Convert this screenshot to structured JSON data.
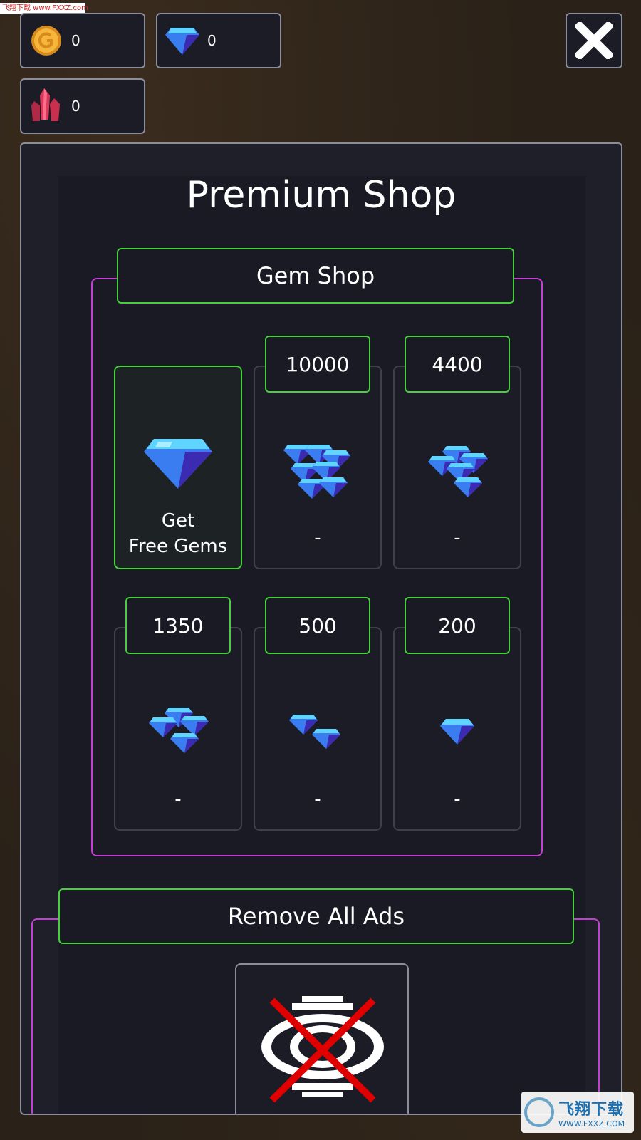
{
  "watermark_top": "飞翔下载 www.FXXZ.com",
  "watermark_bottom": {
    "brand": "飞翔下载",
    "url": "WWW.FXXZ.COM"
  },
  "currencies": [
    {
      "name": "gold-coin-icon",
      "value": "0"
    },
    {
      "name": "blue-gem-icon",
      "value": "0"
    },
    {
      "name": "red-crystal-icon",
      "value": "0"
    }
  ],
  "title": "Premium Shop",
  "gem_shop": {
    "header": "Gem Shop",
    "free_offer": {
      "label": "Get\nFree Gems"
    },
    "packs": [
      {
        "amount": "10000",
        "price": "-",
        "icon": "gem-pile-xl-icon"
      },
      {
        "amount": "4400",
        "price": "-",
        "icon": "gem-pile-large-icon"
      },
      {
        "amount": "1350",
        "price": "-",
        "icon": "gem-pile-medium-icon"
      },
      {
        "amount": "500",
        "price": "-",
        "icon": "gem-pair-icon"
      },
      {
        "amount": "200",
        "price": "-",
        "icon": "single-gem-icon"
      }
    ]
  },
  "remove_ads": {
    "header": "Remove All Ads",
    "icon": "no-ads-eye-icon"
  },
  "colors": {
    "gem_light": "#5fd4ff",
    "gem_mid": "#3a7df0",
    "gem_dark": "#3b2bb3",
    "section_border": "#c63dd6",
    "label_border": "#44d13a",
    "no_ads_cross": "#e00000"
  }
}
